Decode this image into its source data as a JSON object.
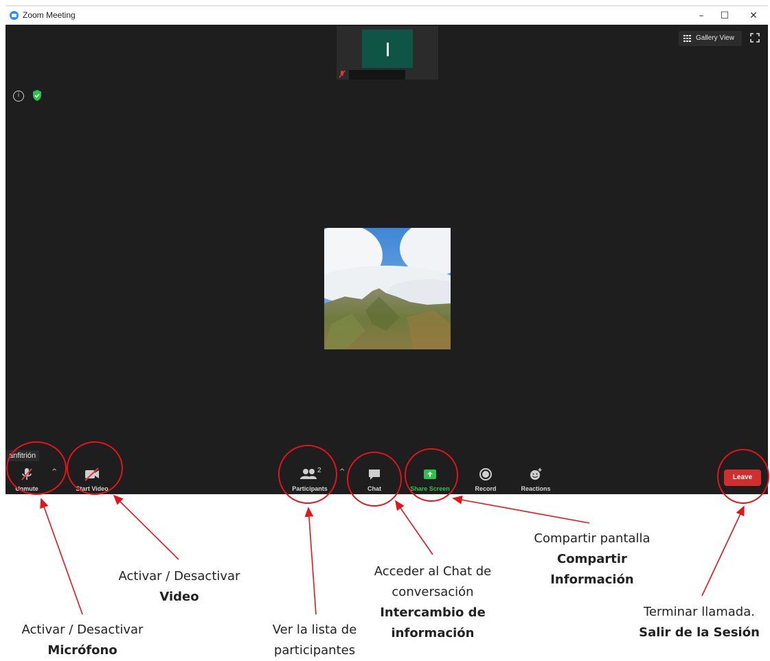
{
  "window": {
    "title": "Zoom Meeting",
    "controls": [
      "–",
      "☐",
      "✕"
    ]
  },
  "meeting": {
    "gallery_view_label": "Gallery View",
    "host_tag": "anfitrión"
  },
  "toolbar": {
    "unmute": "Unmute",
    "start_video": "Start Video",
    "participants": "Participants",
    "participants_count": "2",
    "chat": "Chat",
    "share_screen": "Share Screen",
    "record": "Record",
    "reactions": "Reactions",
    "leave": "Leave",
    "caret": "^"
  },
  "annotations": {
    "microphone": {
      "line1": "Activar / Desactivar",
      "line2": "Micrófono"
    },
    "video": {
      "line1": "Activar / Desactivar",
      "line2": "Video"
    },
    "participants": {
      "line1": "Ver la lista de",
      "line2": "participantes"
    },
    "chat": {
      "line1": "Acceder al Chat de",
      "line2": "conversación",
      "line3": "Intercambio de",
      "line4": "información"
    },
    "share": {
      "line1": "Compartir pantalla",
      "line2": "Compartir",
      "line3": "Información"
    },
    "leave": {
      "line1": "Terminar llamada.",
      "line2": "Salir de la Sesión"
    }
  },
  "colors": {
    "annotation_red": "#e3141a",
    "zoom_blue": "#2d8cff",
    "share_green": "#2cc34d",
    "leave_red": "#cf2f2f",
    "stage_bg": "#1e1e1e"
  }
}
